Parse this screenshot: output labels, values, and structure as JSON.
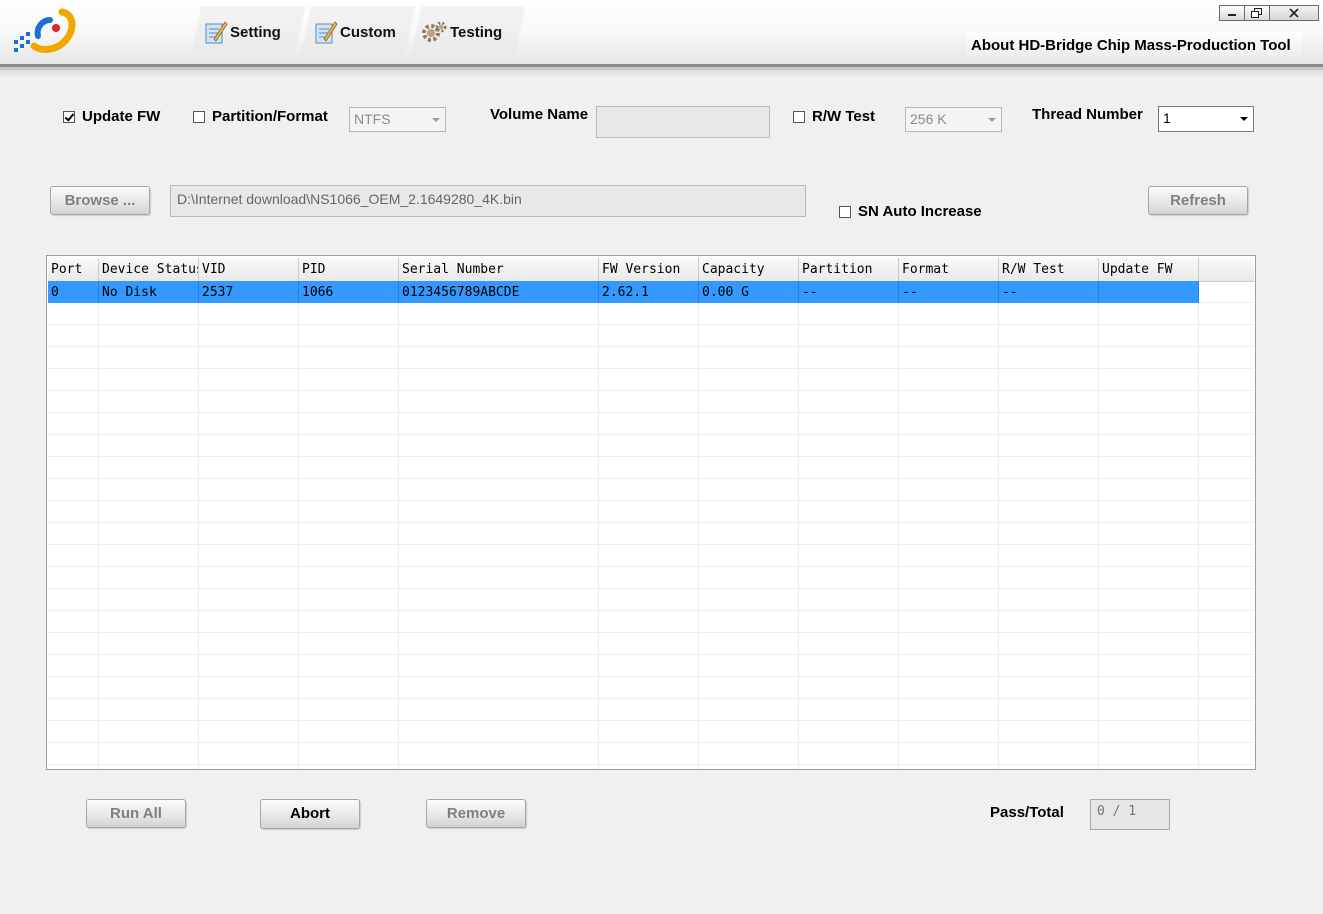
{
  "header": {
    "tabs": [
      {
        "label": "Setting",
        "icon": "pencil-note-icon"
      },
      {
        "label": "Custom",
        "icon": "pencil-note-icon"
      },
      {
        "label": "Testing",
        "icon": "gear-icon"
      }
    ],
    "about_label": "About HD-Bridge Chip Mass-Production Tool"
  },
  "options": {
    "update_fw": {
      "label": "Update FW",
      "checked": true
    },
    "partition_format": {
      "label": "Partition/Format",
      "checked": false,
      "value": "NTFS"
    },
    "volume_name": {
      "label": "Volume Name",
      "value": ""
    },
    "rw_test": {
      "label": "R/W Test",
      "checked": false,
      "value": "256 K"
    },
    "thread_number": {
      "label": "Thread Number",
      "value": "1"
    }
  },
  "file": {
    "browse_label": "Browse ...",
    "path": "D:\\Internet download\\NS1066_OEM_2.1649280_4K.bin",
    "sn_auto_increase": {
      "label": "SN Auto Increase",
      "checked": false
    },
    "refresh_label": "Refresh"
  },
  "grid": {
    "columns": [
      "Port",
      "Device Status",
      "VID",
      "PID",
      "Serial Number",
      "FW Version",
      "Capacity",
      "Partition",
      "Format",
      "R/W Test",
      "Update FW"
    ],
    "rows": [
      [
        "0",
        "No Disk",
        "2537",
        "1066",
        "0123456789ABCDE",
        "2.62.1",
        "0.00 G",
        "--",
        "--",
        "--",
        ""
      ]
    ],
    "selected_color": "#3399ff"
  },
  "footer": {
    "run_all_label": "Run All",
    "abort_label": "Abort",
    "remove_label": "Remove",
    "pass_total_label": "Pass/Total",
    "pass_total_value": "0 / 1"
  }
}
